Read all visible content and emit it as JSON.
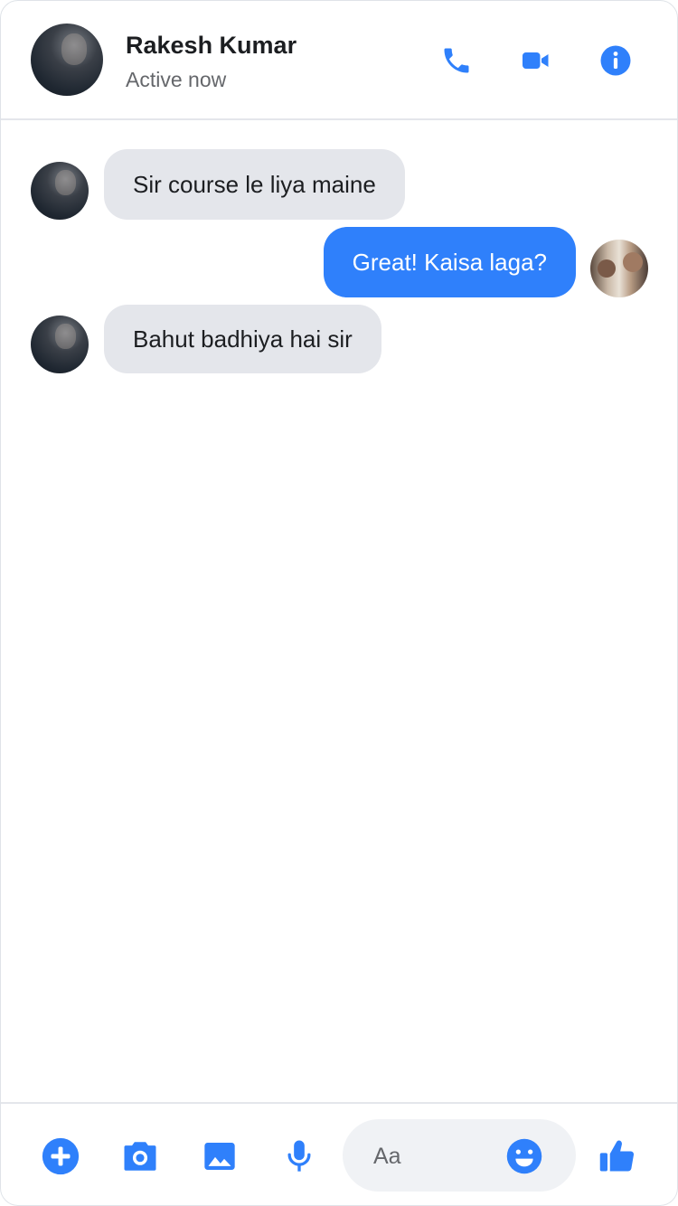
{
  "header": {
    "contact_name": "Rakesh Kumar",
    "contact_status": "Active now",
    "icons": [
      "phone-icon",
      "video-icon",
      "info-icon"
    ]
  },
  "messages": [
    {
      "sender": "contact",
      "text": "Sir course le liya maine"
    },
    {
      "sender": "me",
      "text": "Great! Kaisa laga?"
    },
    {
      "sender": "contact",
      "text": "Bahut badhiya hai sir"
    }
  ],
  "composer": {
    "placeholder": "Aa",
    "icons": [
      "plus-icon",
      "camera-icon",
      "image-icon",
      "microphone-icon",
      "emoji-icon",
      "thumbs-up-icon"
    ]
  },
  "colors": {
    "accent": "#2f80fb",
    "incoming_bubble": "#e4e6eb",
    "composer_bg": "#f0f2f5",
    "text": "#1c1e21",
    "secondary_text": "#65676b"
  }
}
